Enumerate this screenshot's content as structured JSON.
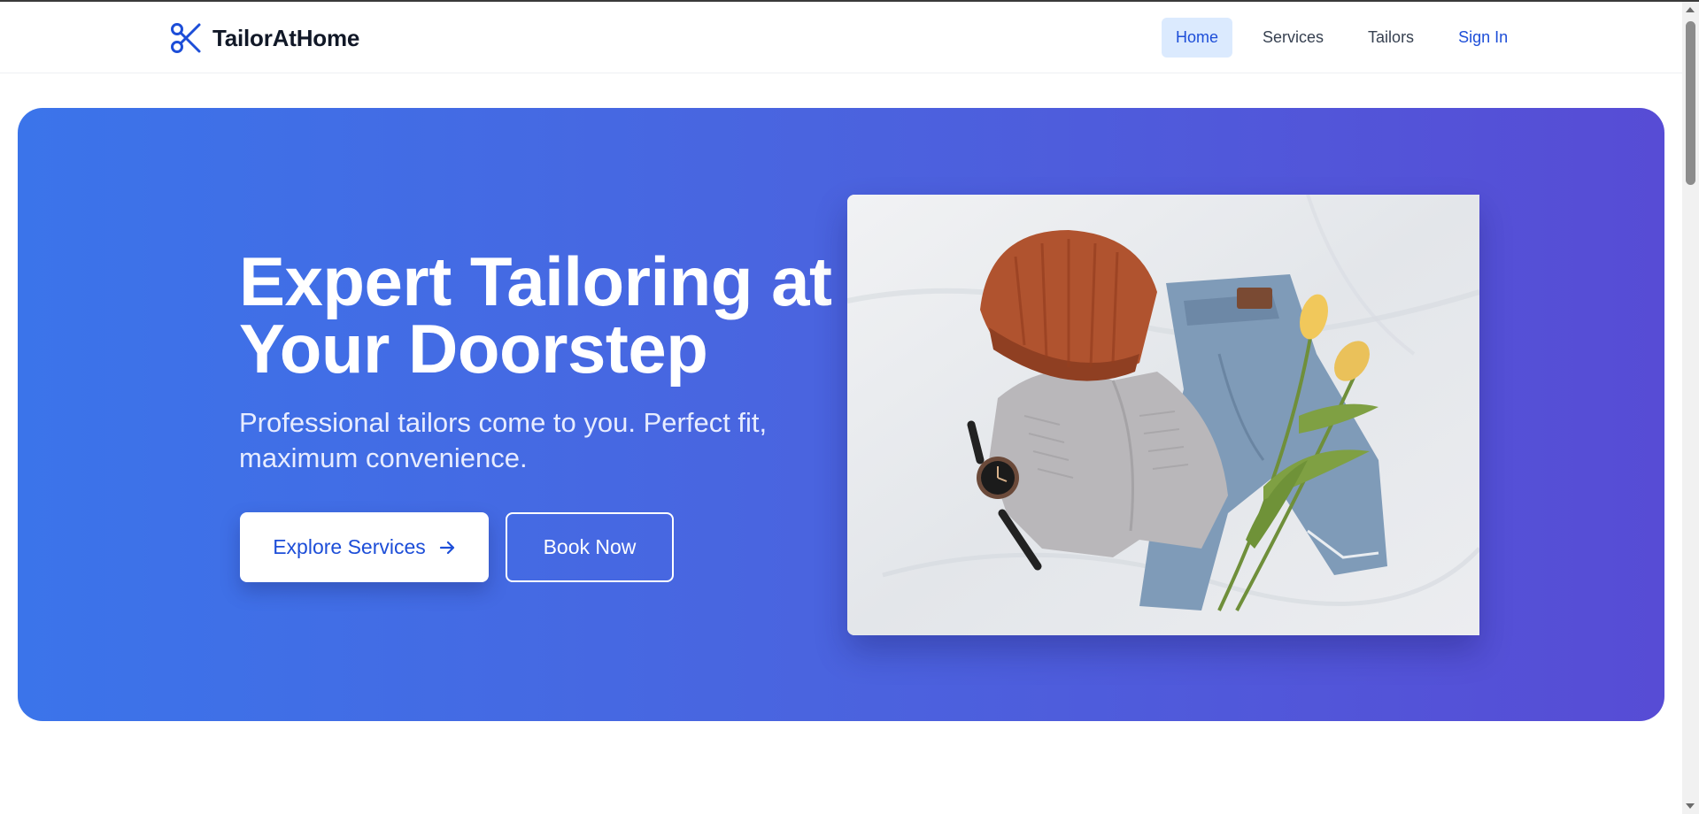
{
  "header": {
    "brand_name": "TailorAtHome",
    "brand_icon": "scissors-icon",
    "nav": [
      {
        "label": "Home",
        "active": true
      },
      {
        "label": "Services",
        "active": false
      },
      {
        "label": "Tailors",
        "active": false
      },
      {
        "label": "Sign In",
        "active": false
      }
    ]
  },
  "hero": {
    "title_line1": "Expert Tailoring at",
    "title_line2": "Your Doorstep",
    "subtitle": "Professional tailors come to you. Perfect fit, maximum convenience.",
    "explore_label": "Explore Services",
    "explore_icon": "arrow-right-icon",
    "book_label": "Book Now",
    "image_alt": "Flat lay of knit beanie, sweater, jeans, watch and tulips"
  },
  "colors": {
    "brand_blue": "#1d4ed8",
    "hero_gradient_start": "#3b74ea",
    "hero_gradient_end": "#574cd5",
    "nav_active_bg": "#dbeafe"
  }
}
